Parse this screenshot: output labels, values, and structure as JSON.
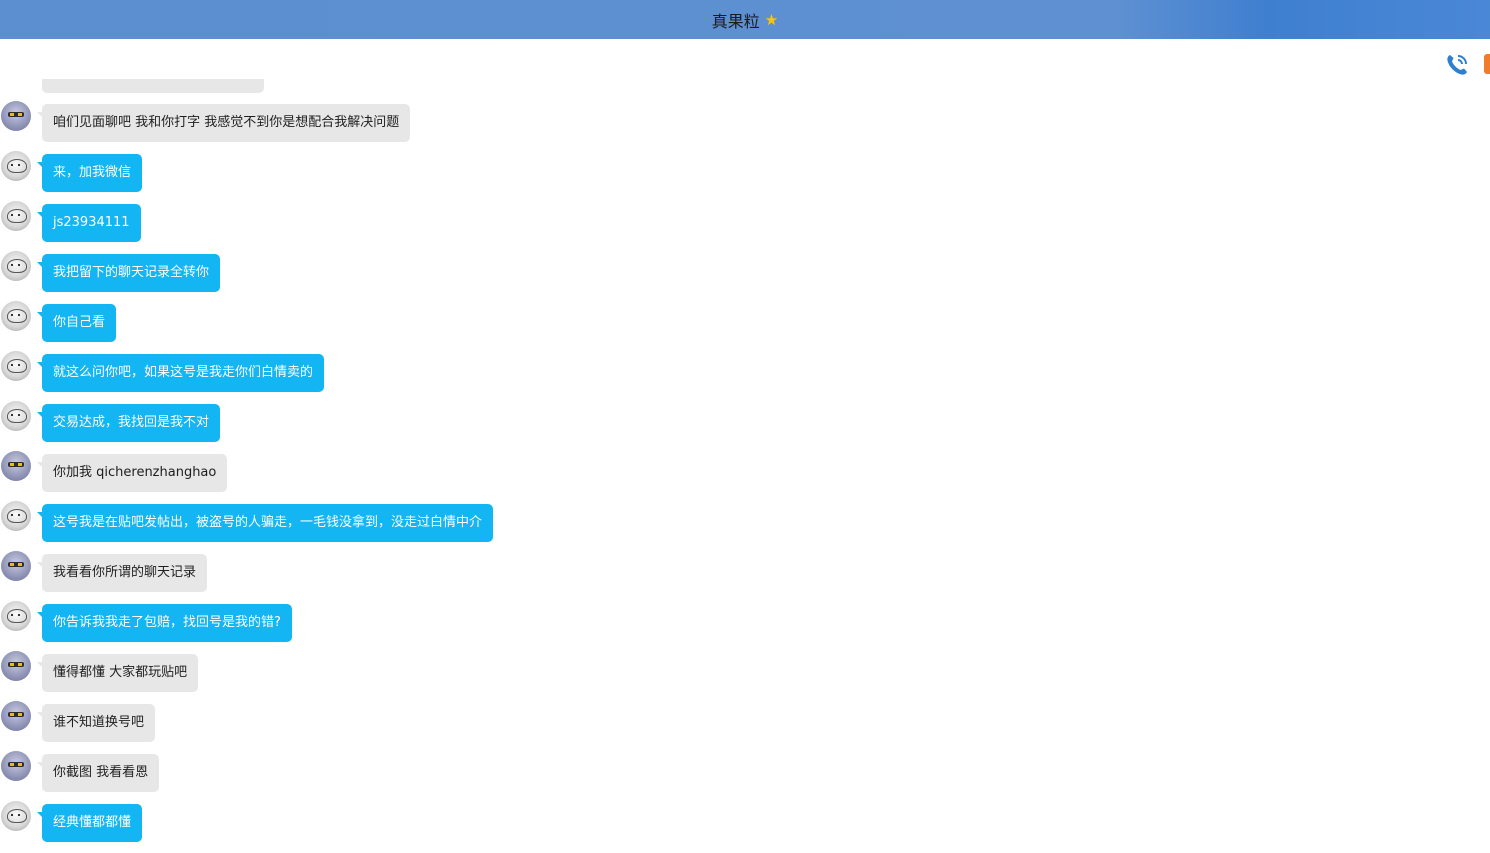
{
  "window": {
    "title": "真果粒",
    "title_badge_icon": "star-icon"
  },
  "toolbar": {
    "icons": [
      "phone-icon",
      "more-icon"
    ]
  },
  "colors": {
    "titlebar": "#5b8fd0",
    "bubble_incoming": "#e7e7e7",
    "bubble_outgoing": "#13b5f2"
  },
  "messages": [
    {
      "sender": "them",
      "text": "咱们见面聊吧  我和你打字 我感觉不到你是想配合我解决问题"
    },
    {
      "sender": "me",
      "text": "来，加我微信"
    },
    {
      "sender": "me",
      "text": "js23934111"
    },
    {
      "sender": "me",
      "text": "我把留下的聊天记录全转你"
    },
    {
      "sender": "me",
      "text": "你自己看"
    },
    {
      "sender": "me",
      "text": "就这么问你吧，如果这号是我走你们白情卖的"
    },
    {
      "sender": "me",
      "text": "交易达成，我找回是我不对"
    },
    {
      "sender": "them",
      "text": "你加我  qicherenzhanghao"
    },
    {
      "sender": "me",
      "text": "这号我是在贴吧发帖出，被盗号的人骗走，一毛钱没拿到，没走过白情中介"
    },
    {
      "sender": "them",
      "text": "我看看你所谓的聊天记录"
    },
    {
      "sender": "me",
      "text": "你告诉我我走了包赔，找回号是我的错?"
    },
    {
      "sender": "them",
      "text": "懂得都懂 大家都玩贴吧"
    },
    {
      "sender": "them",
      "text": "谁不知道换号吧"
    },
    {
      "sender": "them",
      "text": "你截图 我看看恩"
    },
    {
      "sender": "me",
      "text": "经典懂都都懂"
    }
  ]
}
